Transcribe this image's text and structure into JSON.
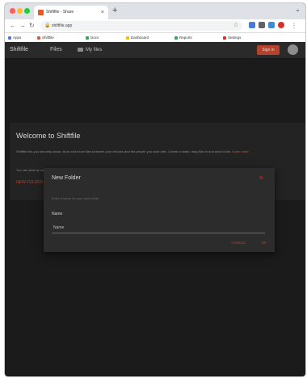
{
  "browser": {
    "tab_title": "Shiftfile - Share",
    "tab_close": "×",
    "new_tab": "+",
    "tab_menu": "⌄",
    "address_url": "shiftfile.app",
    "back": "←",
    "forward": "→",
    "reload": "↻",
    "bookmarks": [
      "Apps",
      "Shiftfile",
      "Docs",
      "Dashboard",
      "Reports",
      "Settings"
    ]
  },
  "app": {
    "brand": "Shiftfile",
    "nav_files": "Files",
    "nav_folder": "My files",
    "signin_label": "Sign in"
  },
  "welcome": {
    "title": "Welcome to Shiftfile",
    "body": "Shiftfile lets you securely share, store and move files between your devices and the people you work with. Create a folder, drag files in and send a link.",
    "link_text": "Learn more",
    "small": "You can start by creating a new folder below.",
    "action_link": "NEW FOLDER"
  },
  "modal": {
    "title": "New Folder",
    "close_icon": "×",
    "hint": "Enter a name for your new folder",
    "field_label": "Name",
    "field_value": "Name",
    "cancel_label": "CANCEL",
    "ok_label": "OK"
  },
  "colors": {
    "accent": "#b4432b",
    "background": "#1b1b1b",
    "modal": "#2c2c2c"
  }
}
